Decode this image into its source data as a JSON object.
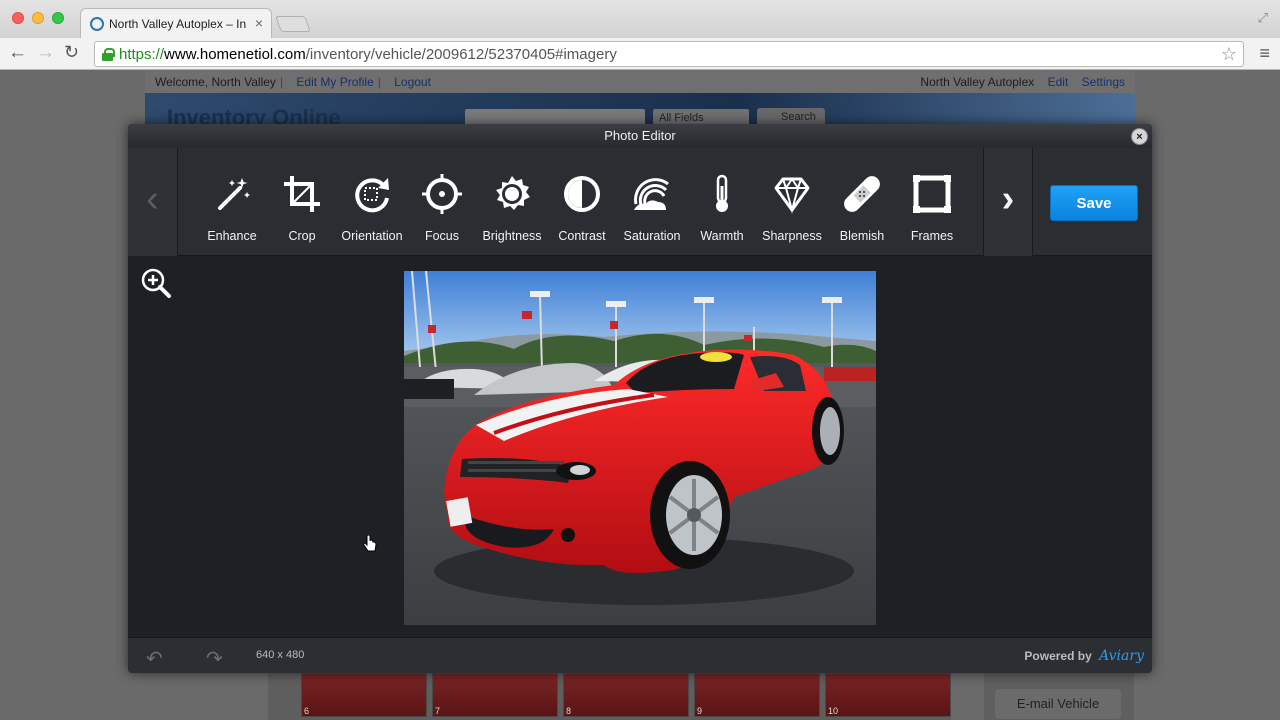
{
  "browser": {
    "tab_title": "North Valley Autoplex – In",
    "tab_close": "×",
    "url_scheme": "https://",
    "url_host": "www.homenetiol.com",
    "url_path": "/inventory/vehicle/2009612/52370405#imagery"
  },
  "site": {
    "welcome": "Welcome, North Valley",
    "edit_profile": "Edit My Profile",
    "logout": "Logout",
    "dealer": "North Valley Autoplex",
    "edit": "Edit",
    "settings": "Settings",
    "logo": "Inventory Online",
    "search_scope": "All Fields",
    "search_button": "Search",
    "email_vehicle": "E-mail Vehicle",
    "thumb_numbers": [
      "6",
      "7",
      "8",
      "9",
      "10"
    ]
  },
  "editor": {
    "title": "Photo Editor",
    "tools": [
      {
        "label": "Enhance",
        "icon": "magic-wand-icon"
      },
      {
        "label": "Crop",
        "icon": "crop-icon"
      },
      {
        "label": "Orientation",
        "icon": "rotate-icon"
      },
      {
        "label": "Focus",
        "icon": "focus-icon"
      },
      {
        "label": "Brightness",
        "icon": "sun-icon"
      },
      {
        "label": "Contrast",
        "icon": "contrast-icon"
      },
      {
        "label": "Saturation",
        "icon": "saturation-icon"
      },
      {
        "label": "Warmth",
        "icon": "thermometer-icon"
      },
      {
        "label": "Sharpness",
        "icon": "diamond-icon"
      },
      {
        "label": "Blemish",
        "icon": "bandage-icon"
      },
      {
        "label": "Frames",
        "icon": "frame-icon"
      }
    ],
    "save": "Save",
    "dimensions": "640 x 480",
    "powered_by": "Powered by",
    "brand": "Aviary"
  }
}
